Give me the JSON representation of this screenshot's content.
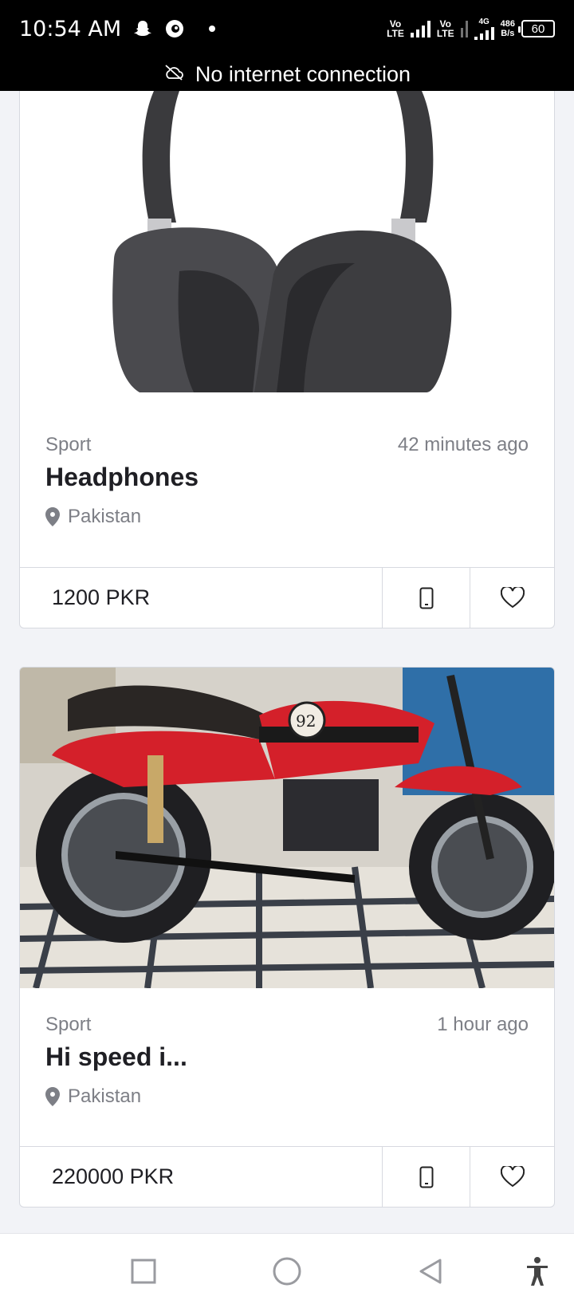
{
  "status_bar": {
    "time": "10:54 AM",
    "sim1_label_top": "Vo",
    "sim1_label_bottom": "LTE",
    "sim2_label_top": "Vo",
    "sim2_label_bottom": "LTE",
    "network_type": "4G",
    "speed_value": "486",
    "speed_unit": "B/s",
    "battery": "60"
  },
  "banner": {
    "text": "No internet connection",
    "icon": "cloud-off-icon"
  },
  "listings": [
    {
      "category": "Sport",
      "time_ago": "42 minutes ago",
      "title": "Headphones",
      "location": "Pakistan",
      "price": "1200 PKR",
      "image": "headphones-photo"
    },
    {
      "category": "Sport",
      "time_ago": "1 hour ago",
      "title": "Hi speed i...",
      "location": "Pakistan",
      "price": "220000 PKR",
      "image": "motorcycle-photo"
    }
  ],
  "nav": {
    "recents": "square-icon",
    "home": "circle-icon",
    "back": "triangle-back-icon",
    "accessibility": "accessibility-icon"
  },
  "colors": {
    "background": "#f2f3f7",
    "card_border": "#d7d9e0",
    "muted_text": "#7d7f86",
    "status_bar": "#000000",
    "motorcycle_red": "#d4202a"
  }
}
